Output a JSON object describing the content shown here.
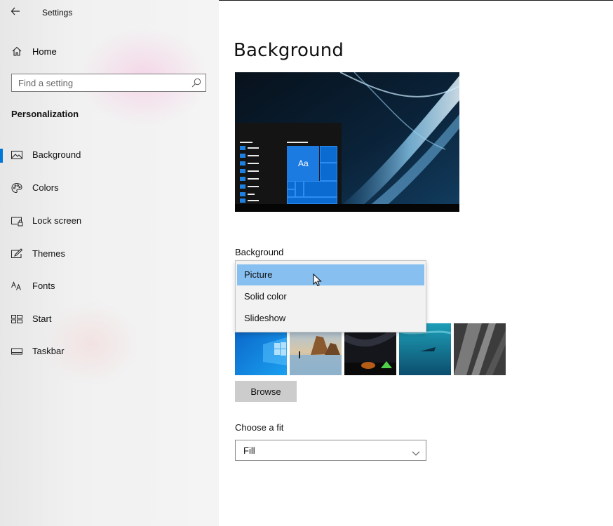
{
  "window": {
    "title": "Settings"
  },
  "sidebar": {
    "home_label": "Home",
    "search_placeholder": "Find a setting",
    "section_title": "Personalization",
    "items": [
      {
        "label": "Background",
        "icon": "picture-icon",
        "active": true
      },
      {
        "label": "Colors",
        "icon": "palette-icon",
        "active": false
      },
      {
        "label": "Lock screen",
        "icon": "lock-screen-icon",
        "active": false
      },
      {
        "label": "Themes",
        "icon": "themes-icon",
        "active": false
      },
      {
        "label": "Fonts",
        "icon": "fonts-icon",
        "active": false
      },
      {
        "label": "Start",
        "icon": "start-icon",
        "active": false
      },
      {
        "label": "Taskbar",
        "icon": "taskbar-icon",
        "active": false
      }
    ]
  },
  "main": {
    "title": "Background",
    "preview": {
      "tile_label": "Aa"
    },
    "background_label": "Background",
    "background_dropdown": {
      "options": [
        "Picture",
        "Solid color",
        "Slideshow"
      ],
      "selected": "Picture"
    },
    "browse_label": "Browse",
    "fit_label": "Choose a fit",
    "fit_value": "Fill"
  },
  "colors": {
    "accent": "#0078d7",
    "selected_option": "#86bff0"
  }
}
